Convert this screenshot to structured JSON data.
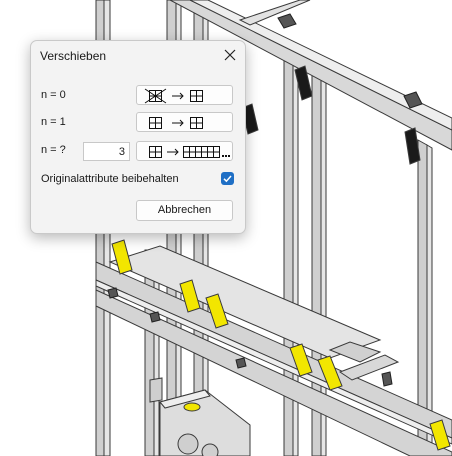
{
  "dialog": {
    "title": "Verschieben",
    "close_icon": "close-icon",
    "rows": [
      {
        "label": "n = 0",
        "button_icon": "copy-none-to-single-icon"
      },
      {
        "label": "n = 1",
        "button_icon": "copy-single-to-single-icon"
      },
      {
        "label": "n = ?",
        "button_icon": "copy-single-to-multiple-icon"
      }
    ],
    "count_value": "3",
    "keep_attributes_label": "Originalattribute beibehalten",
    "keep_attributes_checked": true,
    "cancel_label": "Abbrechen"
  },
  "colors": {
    "accent": "#1f6fc5",
    "dialog_bg": "#f3f3f3",
    "steel": "#c9c9c9",
    "steel_edge": "#3a3a3a",
    "marker_yellow": "#f2e600"
  }
}
